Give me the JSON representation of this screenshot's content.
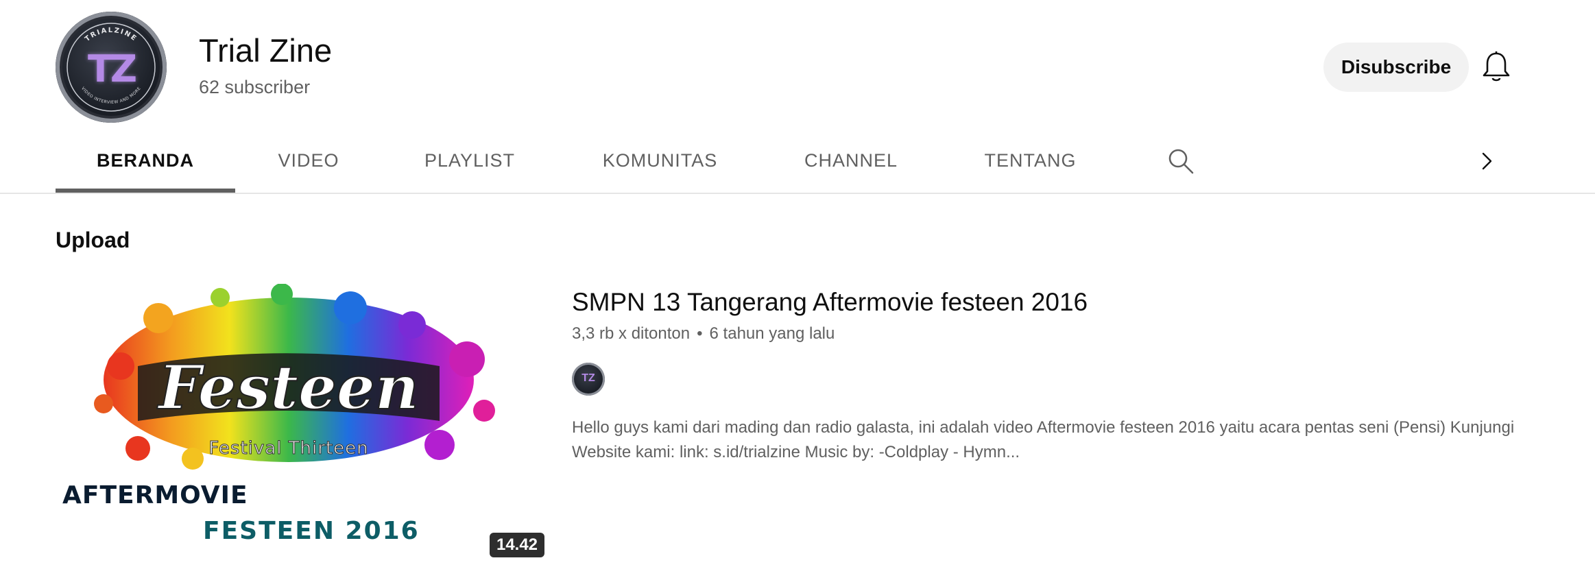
{
  "channel": {
    "name": "Trial Zine",
    "subscribers": "62 subscriber",
    "avatar_monogram": "TZ",
    "avatar_ring_text": "TRIALZINE",
    "avatar_ring_text_bottom": "VIDEO INTERVIEW AND MORE",
    "unsubscribe_label": "Disubscribe"
  },
  "tabs": [
    {
      "label": "BERANDA",
      "active": true
    },
    {
      "label": "VIDEO",
      "active": false
    },
    {
      "label": "PLAYLIST",
      "active": false
    },
    {
      "label": "KOMUNITAS",
      "active": false
    },
    {
      "label": "CHANNEL",
      "active": false
    },
    {
      "label": "TENTANG",
      "active": false
    }
  ],
  "icons": {
    "bell": "bell-icon",
    "search": "search-icon",
    "next": "chevron-right-icon"
  },
  "section": {
    "title": "Upload"
  },
  "video": {
    "title": "SMPN 13 Tangerang Aftermovie festeen 2016",
    "views": "3,3 rb x ditonton",
    "age": "6 tahun yang lalu",
    "duration": "14.42",
    "description": "Hello guys kami dari mading dan radio galasta, ini adalah video Aftermovie festeen 2016 yaitu acara pentas seni (Pensi) Kunjungi Website kami: link: s.id/trialzine Music by: -Coldplay - Hymn...",
    "thumbnail": {
      "logo_text": "Festeen",
      "logo_subtext": "Festival Thirteen",
      "line1": "AFTERMOVIE",
      "line2": "FESTEEN 2016"
    }
  },
  "colors": {
    "text_primary": "#0f0f0f",
    "text_secondary": "#606060",
    "button_bg": "#f2f2f2",
    "divider": "#e5e5e5"
  }
}
